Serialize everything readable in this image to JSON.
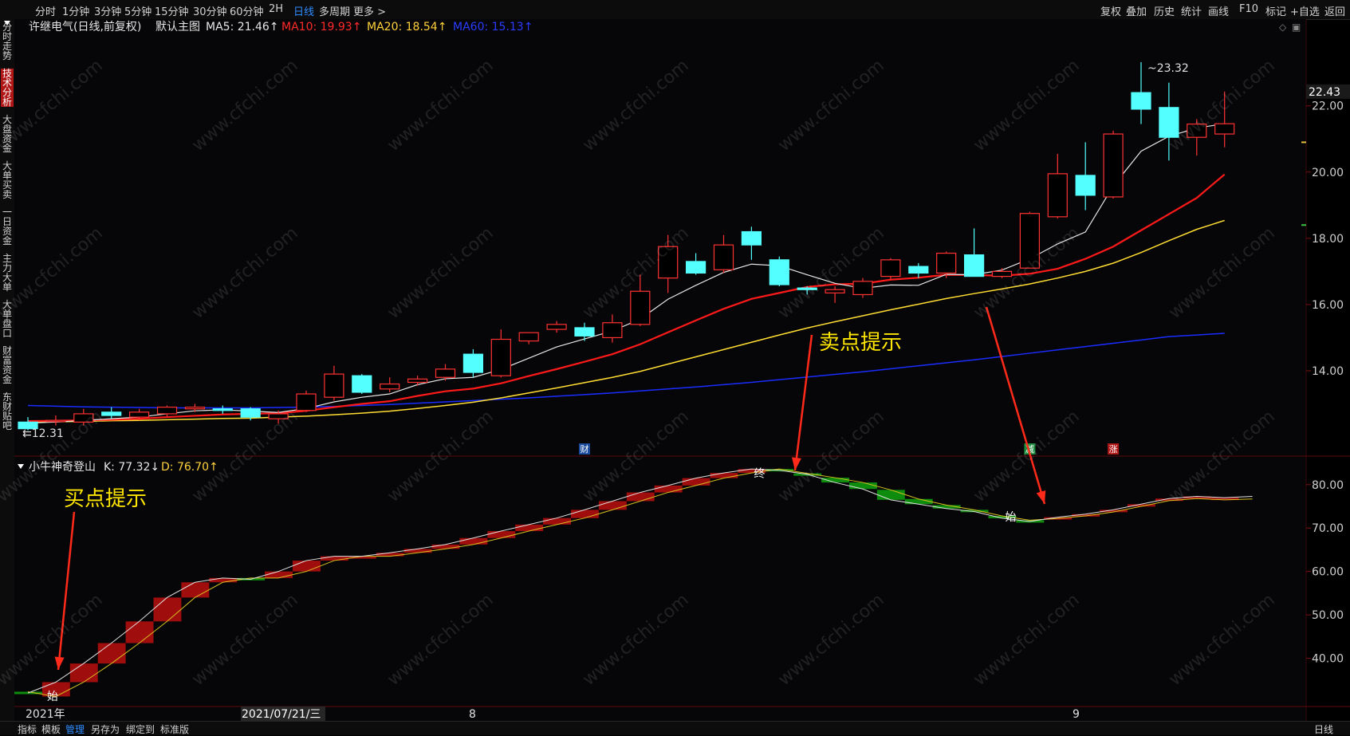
{
  "toolbar": {
    "left_items": [
      "分时",
      "1分钟",
      "3分钟",
      "5分钟",
      "15分钟",
      "30分钟",
      "60分钟",
      "2H",
      "日线",
      "多周期",
      "更多 >"
    ],
    "active_item": "日线",
    "right_items": [
      "复权",
      "叠加",
      "历史",
      "统计",
      "画线",
      "F10",
      "标记",
      "+自选",
      "返回"
    ]
  },
  "sidebar": {
    "items": [
      "分时走势",
      "技术分析",
      "大盘资金",
      "大单买卖",
      "一日资金",
      "主力大单",
      "大单盘口",
      "财富资金",
      "东财贴吧"
    ],
    "active_item": "技术分析"
  },
  "bottombar": {
    "items": [
      "指标",
      "模板",
      "管理",
      "另存为",
      "绑定到",
      "标准版"
    ],
    "active_item": "管理",
    "right_label": "日线",
    "plus": "+",
    "minus": "−"
  },
  "main_header": {
    "title": "许继电气(日线,前复权)",
    "template": "默认主图",
    "ma": [
      {
        "label": "MA5: 21.46↑",
        "color": "#e6e6e6"
      },
      {
        "label": "MA10: 19.93↑",
        "color": "#ff2a2a"
      },
      {
        "label": "MA20: 18.54↑",
        "color": "#ffd23c"
      },
      {
        "label": "MA60: 15.13↑",
        "color": "#2a3cff"
      }
    ]
  },
  "sub_header": {
    "title": "小牛神奇登山",
    "k_label": "K: 77.32↓",
    "d_label": "D: 76.70↑"
  },
  "watermark": "www.cfchi.com",
  "annotations": {
    "sell_hint": "卖点提示",
    "buy_hint": "买点提示",
    "start_mark": "始",
    "end_mark": "终",
    "events": [
      "财",
      "减",
      "涨"
    ]
  },
  "axis": {
    "date_labels": [
      "2021年",
      "2021/07/21/三",
      "8",
      "9"
    ]
  },
  "colors": {
    "up": "#ff3232",
    "down": "#54ffff",
    "ma5": "#e6e6e6",
    "ma10": "#ff1a1a",
    "ma20": "#ffdd33",
    "ma60": "#1a2cff",
    "k_up_fill": "#a00d0d",
    "k_down_fill": "#0e8c0e"
  },
  "chart_data": [
    {
      "type": "candlestick",
      "title": "许继电气(日线,前复权)",
      "ylim": [
        12.0,
        23.8
      ],
      "y_ticks": [
        14.0,
        16.0,
        18.0,
        20.0,
        22.0
      ],
      "current_price": 22.43,
      "max_label": "23.32",
      "min_label": "12.31",
      "candles": [
        {
          "o": 12.45,
          "h": 12.6,
          "c": 12.25,
          "l": 12.2
        },
        {
          "o": 12.5,
          "h": 12.65,
          "c": 12.5,
          "l": 12.35
        },
        {
          "o": 12.45,
          "h": 12.85,
          "c": 12.7,
          "l": 12.35
        },
        {
          "o": 12.75,
          "h": 12.9,
          "c": 12.65,
          "l": 12.55
        },
        {
          "o": 12.6,
          "h": 12.85,
          "c": 12.75,
          "l": 12.5
        },
        {
          "o": 12.7,
          "h": 12.95,
          "c": 12.9,
          "l": 12.6
        },
        {
          "o": 12.85,
          "h": 13.0,
          "c": 12.9,
          "l": 12.75
        },
        {
          "o": 12.85,
          "h": 12.95,
          "c": 12.8,
          "l": 12.7
        },
        {
          "o": 12.85,
          "h": 12.9,
          "c": 12.6,
          "l": 12.5
        },
        {
          "o": 12.55,
          "h": 12.8,
          "c": 12.7,
          "l": 12.4
        },
        {
          "o": 12.8,
          "h": 13.4,
          "c": 13.3,
          "l": 12.75
        },
        {
          "o": 13.2,
          "h": 14.15,
          "c": 13.9,
          "l": 13.1
        },
        {
          "o": 13.85,
          "h": 13.9,
          "c": 13.35,
          "l": 13.3
        },
        {
          "o": 13.45,
          "h": 13.8,
          "c": 13.6,
          "l": 13.35
        },
        {
          "o": 13.65,
          "h": 13.85,
          "c": 13.75,
          "l": 13.55
        },
        {
          "o": 13.8,
          "h": 14.2,
          "c": 14.05,
          "l": 13.7
        },
        {
          "o": 14.5,
          "h": 14.65,
          "c": 13.95,
          "l": 13.8
        },
        {
          "o": 13.85,
          "h": 15.25,
          "c": 14.95,
          "l": 13.8
        },
        {
          "o": 14.9,
          "h": 15.15,
          "c": 15.15,
          "l": 14.8
        },
        {
          "o": 15.25,
          "h": 15.5,
          "c": 15.4,
          "l": 15.15
        },
        {
          "o": 15.3,
          "h": 15.45,
          "c": 15.05,
          "l": 14.9
        },
        {
          "o": 15.0,
          "h": 15.7,
          "c": 15.45,
          "l": 14.85
        },
        {
          "o": 15.4,
          "h": 16.9,
          "c": 16.4,
          "l": 15.35
        },
        {
          "o": 16.8,
          "h": 18.1,
          "c": 17.75,
          "l": 16.35
        },
        {
          "o": 17.3,
          "h": 17.55,
          "c": 16.95,
          "l": 16.9
        },
        {
          "o": 17.05,
          "h": 18.1,
          "c": 17.8,
          "l": 16.95
        },
        {
          "o": 18.2,
          "h": 18.35,
          "c": 17.8,
          "l": 17.35
        },
        {
          "o": 17.35,
          "h": 17.45,
          "c": 16.6,
          "l": 16.55
        },
        {
          "o": 16.5,
          "h": 16.55,
          "c": 16.45,
          "l": 16.3
        },
        {
          "o": 16.35,
          "h": 16.55,
          "c": 16.45,
          "l": 16.05
        },
        {
          "o": 16.3,
          "h": 16.8,
          "c": 16.7,
          "l": 16.2
        },
        {
          "o": 16.85,
          "h": 17.4,
          "c": 17.35,
          "l": 16.75
        },
        {
          "o": 17.15,
          "h": 17.25,
          "c": 16.95,
          "l": 16.8
        },
        {
          "o": 16.95,
          "h": 17.6,
          "c": 17.55,
          "l": 16.8
        },
        {
          "o": 17.5,
          "h": 18.3,
          "c": 16.85,
          "l": 16.85
        },
        {
          "o": 16.85,
          "h": 17.1,
          "c": 17.0,
          "l": 16.8
        },
        {
          "o": 17.1,
          "h": 18.8,
          "c": 18.75,
          "l": 17.1
        },
        {
          "o": 18.65,
          "h": 20.55,
          "c": 19.95,
          "l": 18.6
        },
        {
          "o": 19.9,
          "h": 20.9,
          "c": 19.3,
          "l": 18.85
        },
        {
          "o": 19.25,
          "h": 21.25,
          "c": 21.15,
          "l": 19.2
        },
        {
          "o": 22.4,
          "h": 23.32,
          "c": 21.9,
          "l": 21.45
        },
        {
          "o": 21.95,
          "h": 22.7,
          "c": 21.05,
          "l": 20.35
        },
        {
          "o": 21.05,
          "h": 21.6,
          "c": 21.45,
          "l": 20.5
        },
        {
          "o": 21.15,
          "h": 22.43,
          "c": 21.46,
          "l": 20.75
        }
      ],
      "ma5": [
        12.42,
        12.45,
        12.5,
        12.55,
        12.6,
        12.7,
        12.79,
        12.82,
        12.78,
        12.74,
        12.86,
        13.06,
        13.2,
        13.3,
        13.58,
        13.76,
        13.8,
        14.04,
        14.38,
        14.72,
        14.96,
        15.2,
        15.56,
        16.16,
        16.58,
        16.97,
        17.22,
        17.17,
        16.9,
        16.64,
        16.49,
        16.59,
        16.58,
        16.91,
        16.9,
        17.04,
        17.38,
        17.83,
        18.19,
        19.58,
        20.63,
        21.08,
        21.33,
        21.46
      ],
      "ma10": [
        12.48,
        12.49,
        12.5,
        12.52,
        12.55,
        12.6,
        12.64,
        12.68,
        12.7,
        12.72,
        12.79,
        12.9,
        13.0,
        13.08,
        13.24,
        13.38,
        13.46,
        13.62,
        13.84,
        14.05,
        14.27,
        14.5,
        14.8,
        15.16,
        15.52,
        15.87,
        16.17,
        16.35,
        16.53,
        16.61,
        16.63,
        16.75,
        16.81,
        16.9,
        16.89,
        16.87,
        16.93,
        17.08,
        17.38,
        17.75,
        18.24,
        18.73,
        19.22,
        19.93
      ],
      "ma20": [
        12.45,
        12.46,
        12.47,
        12.49,
        12.5,
        12.52,
        12.54,
        12.56,
        12.57,
        12.6,
        12.63,
        12.67,
        12.72,
        12.78,
        12.86,
        12.95,
        13.05,
        13.18,
        13.33,
        13.48,
        13.64,
        13.8,
        13.98,
        14.2,
        14.42,
        14.64,
        14.86,
        15.08,
        15.29,
        15.48,
        15.66,
        15.84,
        16.01,
        16.18,
        16.33,
        16.47,
        16.62,
        16.8,
        17.0,
        17.25,
        17.57,
        17.93,
        18.27,
        18.54
      ],
      "ma60": [
        12.95,
        12.93,
        12.91,
        12.9,
        12.89,
        12.88,
        12.88,
        12.88,
        12.88,
        12.89,
        12.9,
        12.92,
        12.95,
        12.98,
        13.02,
        13.06,
        13.1,
        13.14,
        13.18,
        13.23,
        13.28,
        13.33,
        13.39,
        13.45,
        13.51,
        13.58,
        13.65,
        13.73,
        13.81,
        13.89,
        13.97,
        14.06,
        14.15,
        14.24,
        14.33,
        14.43,
        14.53,
        14.63,
        14.73,
        14.83,
        14.93,
        15.03,
        15.08,
        15.13
      ]
    },
    {
      "type": "bar",
      "title": "小牛神奇登山",
      "ylim": [
        30,
        84
      ],
      "y_ticks": [
        40.0,
        50.0,
        60.0,
        70.0,
        80.0
      ],
      "K": [
        32.0,
        34.5,
        38.8,
        43.5,
        48.5,
        54.0,
        57.5,
        58.5,
        58.2,
        60.0,
        62.5,
        63.5,
        63.5,
        64.3,
        65.2,
        66.2,
        67.7,
        69.3,
        70.8,
        72.3,
        74.2,
        76.2,
        78.2,
        79.8,
        81.5,
        82.7,
        83.6,
        83.3,
        82.4,
        80.5,
        79.0,
        76.5,
        75.5,
        74.5,
        73.8,
        72.3,
        71.5,
        72.5,
        73.2,
        74.2,
        75.5,
        76.8,
        77.3,
        77.0,
        77.3
      ],
      "D": [
        32.3,
        31.2,
        34.5,
        38.8,
        43.5,
        48.5,
        54.0,
        57.5,
        58.5,
        58.5,
        60.0,
        62.5,
        63.5,
        63.5,
        64.3,
        65.2,
        66.2,
        67.7,
        69.3,
        70.8,
        72.3,
        74.2,
        76.2,
        78.2,
        79.8,
        81.5,
        82.7,
        83.6,
        82.6,
        81.6,
        80.5,
        78.8,
        76.7,
        75.3,
        74.2,
        72.8,
        71.8,
        72.2,
        72.8,
        73.7,
        75.0,
        76.3,
        76.8,
        76.5,
        76.7
      ]
    }
  ]
}
